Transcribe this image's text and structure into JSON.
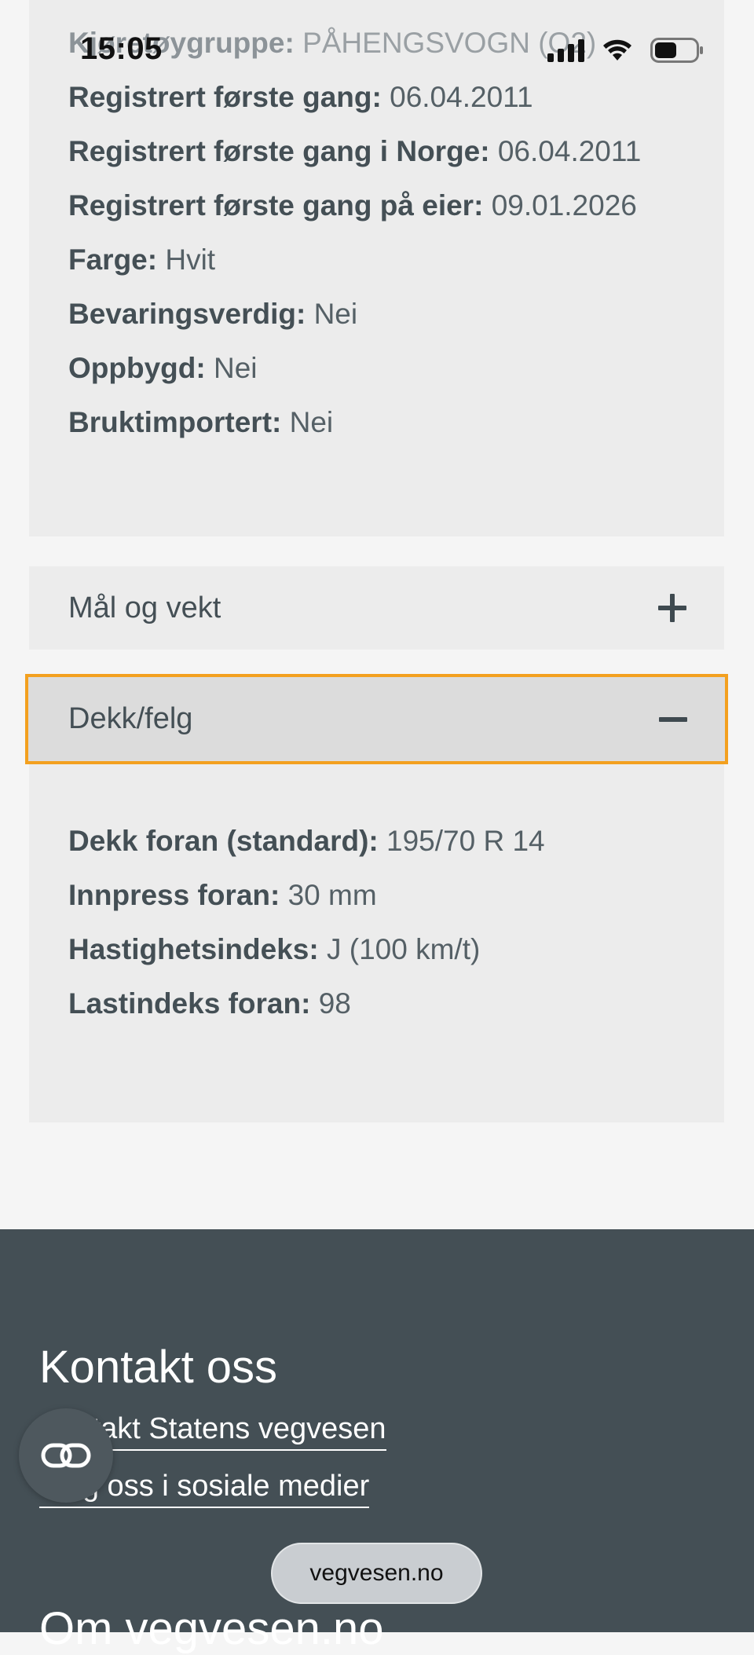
{
  "status_bar": {
    "time": "15:05"
  },
  "registration_details": {
    "rows": [
      {
        "label": "Kjøretøygruppe:",
        "value": "PÅHENGSVOGN (O2)"
      },
      {
        "label": "Registrert første gang:",
        "value": "06.04.2011"
      },
      {
        "label": "Registrert første gang i Norge:",
        "value": "06.04.2011"
      },
      {
        "label": "Registrert første gang på eier:",
        "value": "09.01.2026"
      },
      {
        "label": "Farge:",
        "value": "Hvit"
      },
      {
        "label": "Bevaringsverdig:",
        "value": "Nei"
      },
      {
        "label": "Oppbygd:",
        "value": "Nei"
      },
      {
        "label": "Bruktimportert:",
        "value": "Nei"
      }
    ]
  },
  "accordions": [
    {
      "title": "Mål og vekt",
      "expanded": false,
      "icon": "plus-icon"
    },
    {
      "title": "Dekk/felg",
      "expanded": true,
      "icon": "minus-icon"
    }
  ],
  "tire_details": {
    "rows": [
      {
        "label": "Dekk foran (standard):",
        "value": "195/70 R 14"
      },
      {
        "label": "Innpress foran:",
        "value": "30 mm"
      },
      {
        "label": "Hastighetsindeks:",
        "value": "J (100 km/t)"
      },
      {
        "label": "Lastindeks foran:",
        "value": "98"
      }
    ]
  },
  "footer": {
    "contact_heading": "Kontakt oss",
    "links": [
      "Kontakt Statens vegvesen",
      "Følg oss i sosiale medier"
    ],
    "about_heading": "Om vegvesen.no"
  },
  "browser": {
    "url": "vegvesen.no"
  },
  "colors": {
    "accent_focus": "#f3a01f",
    "footer_bg": "#444f55",
    "card_bg": "#ececec"
  }
}
